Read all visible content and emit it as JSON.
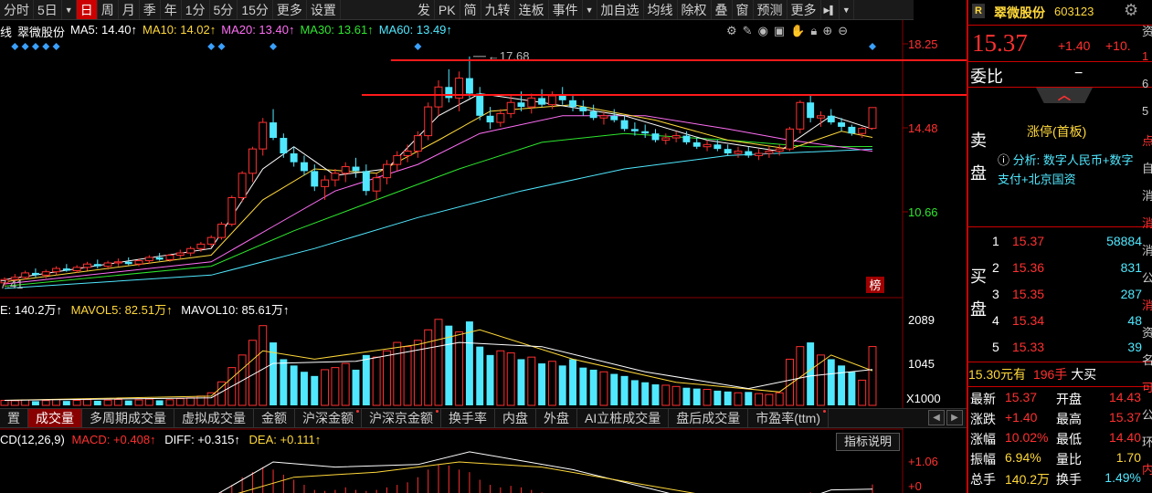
{
  "toolbar": {
    "left": [
      "分时",
      "5日",
      "日",
      "周",
      "月",
      "季",
      "年",
      "1分",
      "5分",
      "15分",
      "更多",
      "设置"
    ],
    "active_index": 2,
    "right": [
      "发",
      "PK",
      "简",
      "九转",
      "连板",
      "事件",
      "加自选",
      "均线",
      "除权",
      "叠",
      "窗",
      "预测",
      "更多"
    ]
  },
  "ma_legend": {
    "stock": "翠微股份",
    "ma5": {
      "label": "MA5: 14.40↑",
      "color": "#ffffff"
    },
    "ma10": {
      "label": "MA10: 14.02↑",
      "color": "#ffd83a"
    },
    "ma20": {
      "label": "MA20: 13.40↑",
      "color": "#ff6ef5"
    },
    "ma30": {
      "label": "MA30: 13.61↑",
      "color": "#2ee62e"
    },
    "ma60": {
      "label": "MA60: 13.49↑",
      "color": "#50e8ff"
    }
  },
  "tool_icons": [
    "gear-icon",
    "pen-icon",
    "eye-icon",
    "briefcase-icon",
    "hand-icon",
    "lock-icon",
    "zoom-in-icon",
    "zoom-out-icon"
  ],
  "price_axis": {
    "top": "18.25",
    "mid": "14.48",
    "low": "10.66"
  },
  "annotations": {
    "high_label": "17.68",
    "low_label": "7.41",
    "bang": "榜"
  },
  "volume": {
    "legend_vol": "140.2万↑",
    "legend_mavol5": "MAVOL5: 82.51万↑",
    "legend_mavol10": "MAVOL10: 85.61万↑",
    "axis_top": "2089",
    "axis_mid": "1045",
    "axis_unit": "X1000"
  },
  "tabs": [
    "成交量",
    "多周期成交量",
    "虚拟成交量",
    "金额",
    "沪深金额",
    "沪深京金额",
    "换手率",
    "内盘",
    "外盘",
    "AI立桩成交量",
    "盘后成交量",
    "市盈率(ttm)"
  ],
  "active_tab": 0,
  "tab_edge_left": "置",
  "macd": {
    "legend_prefix": "CD(12,26,9)",
    "macd": "MACD: +0.408↑",
    "diff": "DIFF: +0.315↑",
    "dea": "DEA: +0.111↑",
    "axis_top": "+1.06",
    "axis_zero": "+0",
    "indicator_button": "指标说明"
  },
  "quote": {
    "badge": "R",
    "name": "翠微股份",
    "code": "603123",
    "price": "15.37",
    "change": "+1.40",
    "change_pct": "+10.",
    "weibi_label": "委比",
    "weibi_value": "−",
    "limit_tag": "涨停(首板)",
    "analysis": "分析: 数字人民币+数字支付+北京国资",
    "sell_label": "卖盘",
    "buy_label": "买盘",
    "bids": [
      {
        "level": "1",
        "price": "15.37",
        "qty": "58884"
      },
      {
        "level": "2",
        "price": "15.36",
        "qty": "831"
      },
      {
        "level": "3",
        "price": "15.35",
        "qty": "287"
      },
      {
        "level": "4",
        "price": "15.34",
        "qty": "48"
      },
      {
        "level": "5",
        "price": "15.33",
        "qty": "39"
      }
    ],
    "trade_line": {
      "price": "15.30元有",
      "qty": "196手",
      "type": "大买"
    },
    "stats": {
      "latest_label": "最新",
      "latest": "15.37",
      "open_label": "开盘",
      "open": "14.43",
      "chg_label": "涨跌",
      "chg": "+1.40",
      "high_label": "最高",
      "high": "15.37",
      "pct_label": "涨幅",
      "pct": "10.02%",
      "low_label": "最低",
      "low": "14.40",
      "amp_label": "振幅",
      "amp": "6.94%",
      "vr_label": "量比",
      "vr": "1.70",
      "total_label": "总手",
      "total": "140.2万",
      "turnover_label": "换手",
      "turnover": "1.49%"
    }
  },
  "edge_chars": [
    "资",
    "1",
    "6",
    "5",
    "点",
    "自",
    "消",
    "消",
    "消",
    "公",
    "消",
    "资",
    "名",
    "可",
    "公",
    "环",
    "内"
  ],
  "chart_data": {
    "type": "candlestick",
    "title": "翠微股份",
    "ylim": [
      7.0,
      18.5
    ],
    "ohlc": [
      [
        7.45,
        7.7,
        7.3,
        7.6
      ],
      [
        7.6,
        7.85,
        7.5,
        7.7
      ],
      [
        7.7,
        8.0,
        7.6,
        7.9
      ],
      [
        7.9,
        8.1,
        7.7,
        7.8
      ],
      [
        7.8,
        8.05,
        7.65,
        7.95
      ],
      [
        7.95,
        8.2,
        7.8,
        8.1
      ],
      [
        8.1,
        8.3,
        7.95,
        8.0
      ],
      [
        8.0,
        8.25,
        7.9,
        8.15
      ],
      [
        8.15,
        8.4,
        8.0,
        8.3
      ],
      [
        8.3,
        8.5,
        8.1,
        8.2
      ],
      [
        8.2,
        8.45,
        8.05,
        8.35
      ],
      [
        8.35,
        8.55,
        8.2,
        8.4
      ],
      [
        8.4,
        8.6,
        8.25,
        8.3
      ],
      [
        8.3,
        8.55,
        8.2,
        8.45
      ],
      [
        8.45,
        8.7,
        8.3,
        8.6
      ],
      [
        8.6,
        8.8,
        8.45,
        8.5
      ],
      [
        8.5,
        8.75,
        8.4,
        8.7
      ],
      [
        8.7,
        8.95,
        8.55,
        8.8
      ],
      [
        8.8,
        9.1,
        8.65,
        9.0
      ],
      [
        9.0,
        9.3,
        8.85,
        9.2
      ],
      [
        9.2,
        9.6,
        9.05,
        9.5
      ],
      [
        9.5,
        10.2,
        9.4,
        10.1
      ],
      [
        10.1,
        11.4,
        10.0,
        11.3
      ],
      [
        11.3,
        12.5,
        11.1,
        12.4
      ],
      [
        12.4,
        13.6,
        12.0,
        13.5
      ],
      [
        13.5,
        14.9,
        13.2,
        14.7
      ],
      [
        14.7,
        15.3,
        13.9,
        14.0
      ],
      [
        14.0,
        14.2,
        13.1,
        13.3
      ],
      [
        13.3,
        13.6,
        12.7,
        12.9
      ],
      [
        12.9,
        13.2,
        12.3,
        12.5
      ],
      [
        12.5,
        12.8,
        11.6,
        11.8
      ],
      [
        11.8,
        12.3,
        11.2,
        12.1
      ],
      [
        12.1,
        12.6,
        11.8,
        12.4
      ],
      [
        12.4,
        12.9,
        12.0,
        12.7
      ],
      [
        12.7,
        13.1,
        12.2,
        12.5
      ],
      [
        12.5,
        12.8,
        11.4,
        11.6
      ],
      [
        11.6,
        12.4,
        11.2,
        12.2
      ],
      [
        12.2,
        13.0,
        11.9,
        12.8
      ],
      [
        12.8,
        13.4,
        12.5,
        13.2
      ],
      [
        13.2,
        13.7,
        12.9,
        13.4
      ],
      [
        13.4,
        14.3,
        13.1,
        14.1
      ],
      [
        14.1,
        15.6,
        13.9,
        15.4
      ],
      [
        15.4,
        16.6,
        15.0,
        16.3
      ],
      [
        16.3,
        17.1,
        15.6,
        15.8
      ],
      [
        15.8,
        17.0,
        15.2,
        16.7
      ],
      [
        16.7,
        17.68,
        15.8,
        16.0
      ],
      [
        16.0,
        16.3,
        14.8,
        15.0
      ],
      [
        15.0,
        15.4,
        14.4,
        14.7
      ],
      [
        14.7,
        15.3,
        14.5,
        15.1
      ],
      [
        15.1,
        15.9,
        14.9,
        15.6
      ],
      [
        15.6,
        16.1,
        15.2,
        15.4
      ],
      [
        15.4,
        16.0,
        15.1,
        15.8
      ],
      [
        15.8,
        16.2,
        15.4,
        15.5
      ],
      [
        15.5,
        16.1,
        15.3,
        15.9
      ],
      [
        15.9,
        16.3,
        15.5,
        15.7
      ],
      [
        15.7,
        15.9,
        15.2,
        15.4
      ],
      [
        15.4,
        15.7,
        15.0,
        15.2
      ],
      [
        15.2,
        15.5,
        14.8,
        14.9
      ],
      [
        14.9,
        15.2,
        14.6,
        15.0
      ],
      [
        15.0,
        15.3,
        14.7,
        14.8
      ],
      [
        14.8,
        15.0,
        14.3,
        14.4
      ],
      [
        14.4,
        14.7,
        14.1,
        14.3
      ],
      [
        14.3,
        14.6,
        14.0,
        14.2
      ],
      [
        14.2,
        14.4,
        13.8,
        13.9
      ],
      [
        13.9,
        14.2,
        13.7,
        14.0
      ],
      [
        14.0,
        14.3,
        13.8,
        14.1
      ],
      [
        14.1,
        14.3,
        13.7,
        13.8
      ],
      [
        13.8,
        14.0,
        13.5,
        13.6
      ],
      [
        13.6,
        13.9,
        13.4,
        13.7
      ],
      [
        13.7,
        13.9,
        13.4,
        13.5
      ],
      [
        13.5,
        13.7,
        13.2,
        13.3
      ],
      [
        13.3,
        13.6,
        13.1,
        13.4
      ],
      [
        13.4,
        13.6,
        13.1,
        13.2
      ],
      [
        13.2,
        13.5,
        13.0,
        13.3
      ],
      [
        13.3,
        13.6,
        13.1,
        13.4
      ],
      [
        13.4,
        13.7,
        13.2,
        13.5
      ],
      [
        13.5,
        14.5,
        13.4,
        14.4
      ],
      [
        14.4,
        15.7,
        14.2,
        15.6
      ],
      [
        15.6,
        15.9,
        14.7,
        14.9
      ],
      [
        14.9,
        15.2,
        14.5,
        15.0
      ],
      [
        15.0,
        15.3,
        14.6,
        14.7
      ],
      [
        14.7,
        14.9,
        14.3,
        14.5
      ],
      [
        14.5,
        14.6,
        14.1,
        14.2
      ],
      [
        14.2,
        14.5,
        14.0,
        14.43
      ],
      [
        14.43,
        15.37,
        14.4,
        15.37
      ]
    ],
    "ma": {
      "ma5": [
        [
          0,
          7.6
        ],
        [
          20,
          9.0
        ],
        [
          25,
          12.6
        ],
        [
          28,
          13.6
        ],
        [
          32,
          12.3
        ],
        [
          37,
          12.6
        ],
        [
          42,
          15.0
        ],
        [
          46,
          16.0
        ],
        [
          52,
          15.6
        ],
        [
          60,
          15.0
        ],
        [
          68,
          13.9
        ],
        [
          75,
          13.4
        ],
        [
          80,
          15.0
        ],
        [
          84,
          14.4
        ]
      ],
      "ma10": [
        [
          0,
          7.5
        ],
        [
          20,
          8.7
        ],
        [
          25,
          11.2
        ],
        [
          30,
          12.6
        ],
        [
          36,
          12.4
        ],
        [
          42,
          13.9
        ],
        [
          47,
          15.2
        ],
        [
          55,
          15.5
        ],
        [
          63,
          14.8
        ],
        [
          70,
          13.9
        ],
        [
          76,
          13.5
        ],
        [
          81,
          14.3
        ],
        [
          84,
          14.02
        ]
      ],
      "ma20": [
        [
          0,
          7.4
        ],
        [
          20,
          8.4
        ],
        [
          26,
          10.0
        ],
        [
          32,
          11.6
        ],
        [
          40,
          12.8
        ],
        [
          46,
          14.2
        ],
        [
          54,
          15.0
        ],
        [
          62,
          15.0
        ],
        [
          70,
          14.4
        ],
        [
          76,
          13.9
        ],
        [
          84,
          13.4
        ]
      ],
      "ma30": [
        [
          0,
          7.3
        ],
        [
          20,
          8.2
        ],
        [
          28,
          9.8
        ],
        [
          36,
          11.2
        ],
        [
          44,
          12.6
        ],
        [
          52,
          13.8
        ],
        [
          60,
          14.2
        ],
        [
          70,
          13.9
        ],
        [
          78,
          13.6
        ],
        [
          84,
          13.61
        ]
      ],
      "ma60": [
        [
          0,
          7.2
        ],
        [
          20,
          7.8
        ],
        [
          30,
          9.0
        ],
        [
          40,
          10.4
        ],
        [
          50,
          11.6
        ],
        [
          60,
          12.6
        ],
        [
          70,
          13.2
        ],
        [
          84,
          13.49
        ]
      ]
    },
    "volume": {
      "ylim_thousand": [
        0,
        2089
      ],
      "values_thousand": [
        120,
        110,
        130,
        100,
        115,
        140,
        105,
        120,
        135,
        110,
        125,
        140,
        115,
        130,
        150,
        120,
        135,
        160,
        180,
        220,
        300,
        560,
        900,
        1200,
        1550,
        1900,
        1500,
        1100,
        950,
        800,
        700,
        850,
        900,
        1000,
        850,
        1200,
        1150,
        1300,
        1500,
        1400,
        1550,
        1800,
        2050,
        1900,
        1750,
        2000,
        1400,
        1200,
        1300,
        1250,
        1100,
        1150,
        1000,
        1050,
        950,
        1100,
        900,
        850,
        800,
        750,
        700,
        600,
        550,
        500,
        480,
        450,
        420,
        400,
        380,
        350,
        330,
        300,
        320,
        280,
        260,
        300,
        1100,
        1400,
        1500,
        1200,
        1100,
        950,
        800,
        600,
        1402
      ],
      "mavol5_thousand": [
        [
          0,
          120
        ],
        [
          20,
          220
        ],
        [
          25,
          1300
        ],
        [
          30,
          1100
        ],
        [
          40,
          1450
        ],
        [
          46,
          1800
        ],
        [
          55,
          1100
        ],
        [
          65,
          550
        ],
        [
          75,
          320
        ],
        [
          80,
          1200
        ],
        [
          84,
          825
        ]
      ],
      "mavol10_thousand": [
        [
          0,
          120
        ],
        [
          20,
          180
        ],
        [
          26,
          1000
        ],
        [
          34,
          1050
        ],
        [
          44,
          1500
        ],
        [
          52,
          1400
        ],
        [
          62,
          800
        ],
        [
          72,
          400
        ],
        [
          78,
          700
        ],
        [
          84,
          856
        ]
      ]
    },
    "macd": {
      "ylim": [
        -0.3,
        1.3
      ],
      "hist": [
        0,
        0,
        0,
        0,
        0,
        0,
        0,
        0,
        0,
        0,
        0,
        0,
        0,
        0,
        0,
        0.01,
        0.02,
        0.03,
        0.05,
        0.08,
        0.12,
        0.25,
        0.4,
        0.55,
        0.65,
        0.75,
        0.7,
        0.6,
        0.5,
        0.4,
        0.3,
        0.28,
        0.3,
        0.35,
        0.3,
        0.28,
        0.3,
        0.35,
        0.4,
        0.45,
        0.55,
        0.7,
        0.8,
        0.78,
        0.7,
        0.65,
        0.5,
        0.4,
        0.35,
        0.38,
        0.35,
        0.3,
        0.25,
        0.2,
        0.15,
        0.1,
        0.05,
        0.02,
        -0.02,
        -0.05,
        -0.08,
        -0.1,
        -0.12,
        -0.12,
        -0.1,
        -0.09,
        -0.08,
        -0.07,
        -0.06,
        -0.05,
        -0.04,
        -0.03,
        -0.02,
        -0.01,
        0.0,
        0.01,
        0.1,
        0.2,
        0.25,
        0.22,
        0.2,
        0.18,
        0.15,
        0.12,
        0.408
      ],
      "diff": [
        [
          0,
          0
        ],
        [
          20,
          0.15
        ],
        [
          26,
          0.85
        ],
        [
          32,
          0.75
        ],
        [
          40,
          0.8
        ],
        [
          45,
          1.05
        ],
        [
          55,
          0.7
        ],
        [
          65,
          0.2
        ],
        [
          75,
          -0.05
        ],
        [
          80,
          0.3
        ],
        [
          84,
          0.315
        ]
      ],
      "dea": [
        [
          0,
          0
        ],
        [
          20,
          0.08
        ],
        [
          28,
          0.55
        ],
        [
          36,
          0.65
        ],
        [
          44,
          0.85
        ],
        [
          52,
          0.75
        ],
        [
          62,
          0.4
        ],
        [
          72,
          0.05
        ],
        [
          80,
          0.08
        ],
        [
          84,
          0.111
        ]
      ]
    },
    "markers_at_index": [
      1,
      2,
      3,
      4,
      5,
      20,
      21,
      26,
      40,
      84
    ]
  }
}
